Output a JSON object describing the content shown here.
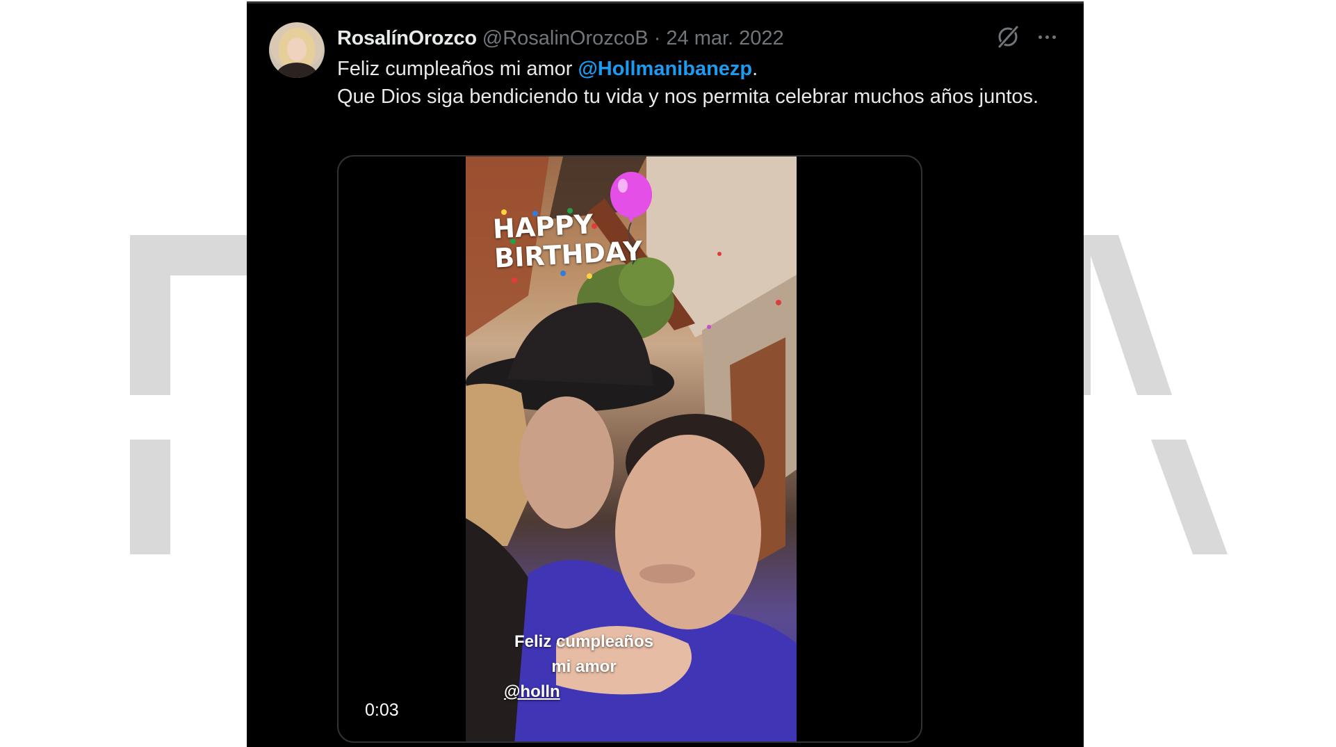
{
  "tweet": {
    "display_name": "RosalínOrozco",
    "handle": "@RosalinOrozcoB",
    "separator": "·",
    "date": "24 mar. 2022",
    "text_part1": "Feliz cumpleaños mi amor ",
    "mention": "@Hollmanibanezp",
    "text_part2": ".",
    "text_line2": "Que Dios siga bendiciendo tu vida y nos permita celebrar muchos años juntos."
  },
  "media": {
    "sticker_line1": "HAPPY",
    "sticker_line2": "BIRTHDAY",
    "overlay_line1": "Feliz cumpleaños",
    "overlay_line2": "mi amor",
    "overlay_mention": "@holln",
    "video_time": "0:03"
  },
  "icons": {
    "grok": "grok-icon",
    "more": "more-icon",
    "balloon": "balloon-icon"
  },
  "colors": {
    "background": "#000000",
    "text": "#e7e9ea",
    "secondary": "#71767b",
    "mention": "#1d9bf0",
    "balloon": "#e44fe8",
    "watermark": "#d9d9d9"
  }
}
